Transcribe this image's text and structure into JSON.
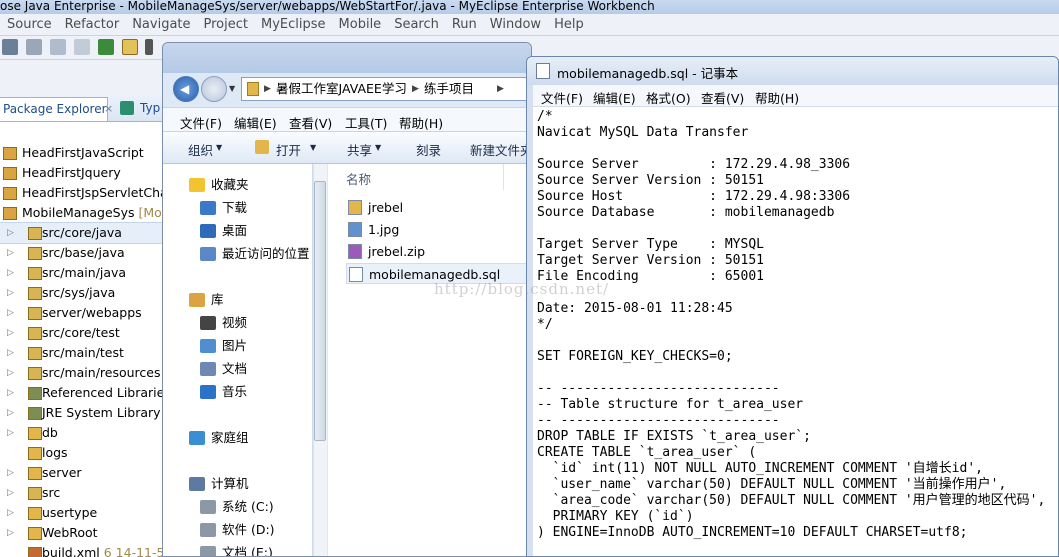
{
  "eclipse": {
    "title": "ose Java Enterprise - MobileManageSys/server/webapps/WebStartFor/.java - MyEclipse Enterprise Workbench",
    "menu": [
      "Source",
      "Refactor",
      "Navigate",
      "Project",
      "MyEclipse",
      "Mobile",
      "Search",
      "Run",
      "Window",
      "Help"
    ],
    "tabs": {
      "package_explorer": "Package Explorer",
      "type": "Typ"
    },
    "tree": [
      {
        "label": "HeadFirstJavaScript",
        "icon": "project-icon",
        "arrow": false
      },
      {
        "label": "HeadFirstJquery",
        "icon": "project-icon",
        "arrow": false
      },
      {
        "label": "HeadFirstJspServletChap",
        "icon": "project-icon",
        "arrow": false
      },
      {
        "label": "MobileManageSys",
        "suffix": "[Mo",
        "icon": "project-icon",
        "arrow": false
      },
      {
        "label": "src/core/java",
        "icon": "package-folder-icon",
        "arrow": true
      },
      {
        "label": "src/base/java",
        "icon": "package-folder-icon",
        "arrow": true
      },
      {
        "label": "src/main/java",
        "icon": "package-folder-icon",
        "arrow": true
      },
      {
        "label": "src/sys/java",
        "icon": "package-folder-icon",
        "arrow": true
      },
      {
        "label": "server/webapps",
        "icon": "package-folder-icon",
        "arrow": true
      },
      {
        "label": "src/core/test",
        "icon": "package-folder-icon",
        "arrow": true
      },
      {
        "label": "src/main/test",
        "icon": "package-folder-icon",
        "arrow": true
      },
      {
        "label": "src/main/resources",
        "icon": "package-folder-icon",
        "arrow": true
      },
      {
        "label": "Referenced Libraries",
        "icon": "library-icon",
        "arrow": true
      },
      {
        "label": "JRE System Library",
        "suffix": "[J",
        "icon": "library-icon",
        "arrow": true
      },
      {
        "label": "db",
        "icon": "folder-icon",
        "arrow": true
      },
      {
        "label": "logs",
        "icon": "folder-icon",
        "arrow": false
      },
      {
        "label": "server",
        "icon": "folder-icon",
        "arrow": true
      },
      {
        "label": "src",
        "icon": "package-folder-icon",
        "arrow": true
      },
      {
        "label": "usertype",
        "icon": "folder-icon",
        "arrow": true
      },
      {
        "label": "WebRoot",
        "icon": "folder-icon",
        "arrow": true
      },
      {
        "label": "build.xml",
        "suffix": "6  14-11-5",
        "icon": "xml-file-icon",
        "arrow": false
      }
    ]
  },
  "explorer": {
    "address": [
      "暑假工作室JAVAEE学习",
      "练手项目"
    ],
    "menu": [
      "文件(F)",
      "编辑(E)",
      "查看(V)",
      "工具(T)",
      "帮助(H)"
    ],
    "commands": [
      "组织",
      "打开",
      "共享",
      "刻录",
      "新建文件夹"
    ],
    "nav": [
      {
        "label": "收藏夹",
        "icon": "star-icon",
        "group": true
      },
      {
        "label": "下载",
        "icon": "download-folder-icon",
        "group": false
      },
      {
        "label": "桌面",
        "icon": "desktop-icon",
        "group": false
      },
      {
        "label": "最近访问的位置",
        "icon": "recent-places-icon",
        "group": false
      },
      {
        "label": "库",
        "icon": "library-folder-icon",
        "group": true
      },
      {
        "label": "视频",
        "icon": "video-icon",
        "group": false
      },
      {
        "label": "图片",
        "icon": "pictures-icon",
        "group": false
      },
      {
        "label": "文档",
        "icon": "documents-icon",
        "group": false
      },
      {
        "label": "音乐",
        "icon": "music-icon",
        "group": false
      },
      {
        "label": "家庭组",
        "icon": "homegroup-icon",
        "group": true
      },
      {
        "label": "计算机",
        "icon": "computer-icon",
        "group": true
      },
      {
        "label": "系统 (C:)",
        "icon": "drive-icon",
        "group": false
      },
      {
        "label": "软件 (D:)",
        "icon": "drive-icon",
        "group": false
      },
      {
        "label": "文档 (E:)",
        "icon": "drive-icon",
        "group": false
      }
    ],
    "column_header": "名称",
    "files": [
      {
        "label": "jrebel",
        "icon": "folder-icon"
      },
      {
        "label": "1.jpg",
        "icon": "image-file-icon"
      },
      {
        "label": "jrebel.zip",
        "icon": "zip-file-icon"
      },
      {
        "label": "mobilemanagedb.sql",
        "icon": "text-file-icon",
        "selected": true
      }
    ]
  },
  "notepad": {
    "title": "mobilemanagedb.sql - 记事本",
    "menu": [
      "文件(F)",
      "编辑(E)",
      "格式(O)",
      "查看(V)",
      "帮助(H)"
    ],
    "lines": [
      "/*",
      "Navicat MySQL Data Transfer",
      "",
      "Source Server         : 172.29.4.98_3306",
      "Source Server Version : 50151",
      "Source Host           : 172.29.4.98:3306",
      "Source Database       : mobilemanagedb",
      "",
      "Target Server Type    : MYSQL",
      "Target Server Version : 50151",
      "File Encoding         : 65001",
      "",
      "Date: 2015-08-01 11:28:45",
      "*/",
      "",
      "SET FOREIGN_KEY_CHECKS=0;",
      "",
      "-- ----------------------------",
      "-- Table structure for t_area_user",
      "-- ----------------------------",
      "DROP TABLE IF EXISTS `t_area_user`;",
      "CREATE TABLE `t_area_user` (",
      "  `id` int(11) NOT NULL AUTO_INCREMENT COMMENT '自增长id',",
      "  `user_name` varchar(50) DEFAULT NULL COMMENT '当前操作用户',",
      "  `area_code` varchar(50) DEFAULT NULL COMMENT '用户管理的地区代码',",
      "  PRIMARY KEY (`id`)",
      ") ENGINE=InnoDB AUTO_INCREMENT=10 DEFAULT CHARSET=utf8;"
    ]
  },
  "watermark": "http://blog.csdn.net/"
}
